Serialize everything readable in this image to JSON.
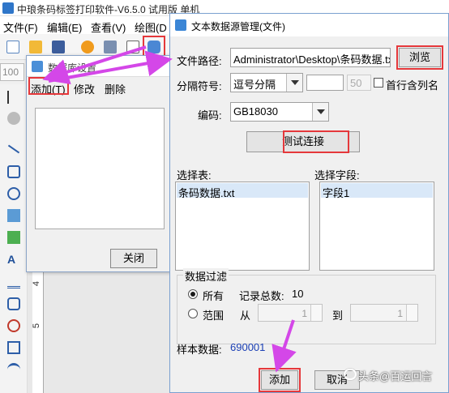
{
  "app": {
    "title": "中琅条码标签打印软件-V6.5.0 试用版 单机",
    "menu": [
      "文件(F)",
      "编辑(E)",
      "查看(V)",
      "绘图(D"
    ],
    "zoom_placeholder": "100"
  },
  "ruler": {
    "marks": [
      "4",
      "5"
    ]
  },
  "ds_window": {
    "title": "数据库设置",
    "menu": {
      "add": "添加(T)",
      "modify": "修改",
      "delete": "删除"
    },
    "close_label": "关闭"
  },
  "dialog": {
    "title": "文本数据源管理(文件)",
    "file_path": {
      "label": "文件路径:",
      "value": "Administrator\\Desktop\\条码数据.txt",
      "browse_label": "浏览"
    },
    "separator": {
      "label": "分隔符号:",
      "value": "逗号分隔",
      "custom_value": "",
      "max_value": "50",
      "first_row_label": "首行含列名",
      "first_row_checked": false
    },
    "encoding": {
      "label": "编码:",
      "value": "GB18030"
    },
    "test_button": "测试连接",
    "tables": {
      "label": "选择表:",
      "items": [
        "条码数据.txt"
      ]
    },
    "fields": {
      "label": "选择字段:",
      "items": [
        "字段1"
      ]
    },
    "filter": {
      "legend": "数据过滤",
      "all_label": "所有",
      "record_count_label": "记录总数:",
      "record_count": "10",
      "range_label": "范围",
      "from_label": "从",
      "from_value": "1",
      "to_label": "到",
      "to_value": "1"
    },
    "sample": {
      "label": "样本数据:",
      "value": "690001"
    },
    "add_button": "添加",
    "cancel_button": "取消"
  },
  "watermark": "头条@百运回言",
  "colors": {
    "highlight": "#e5383b",
    "arrow": "#d447e8",
    "sample_value": "#1a3fb5"
  }
}
